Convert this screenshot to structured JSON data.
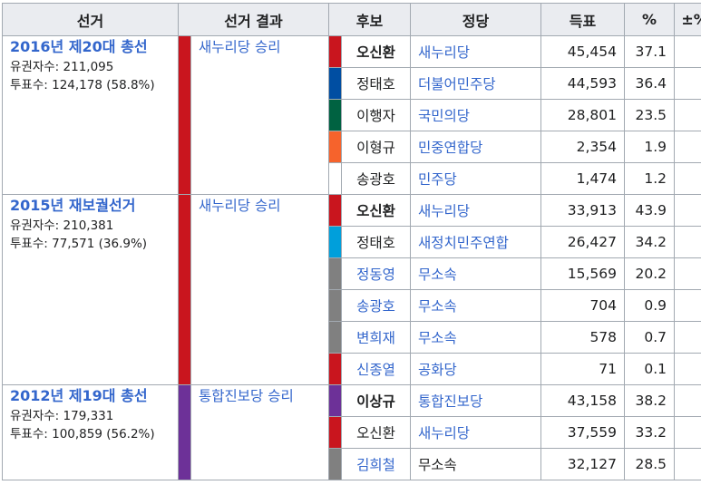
{
  "headers": {
    "election": "선거",
    "result": "선거 결과",
    "candidate": "후보",
    "party": "정당",
    "votes": "득표",
    "pct": "%",
    "change": "±%"
  },
  "elections": [
    {
      "title": "2016년 제20대 총선",
      "electors": "유권자수: 211,095",
      "turnout": "투표수: 124,178 (58.8%)",
      "result": "새누리당 승리",
      "result_color": "#c9151e",
      "candidates": [
        {
          "name": "오신환",
          "party": "새누리당",
          "votes": "45,454",
          "pct": "37.1",
          "change": "",
          "color": "#c9151e"
        },
        {
          "name": "정태호",
          "party": "더불어민주당",
          "votes": "44,593",
          "pct": "36.4",
          "change": "",
          "color": "#004ea2"
        },
        {
          "name": "이행자",
          "party": "국민의당",
          "votes": "28,801",
          "pct": "23.5",
          "change": "",
          "color": "#006241"
        },
        {
          "name": "이형규",
          "party": "민중연합당",
          "votes": "2,354",
          "pct": "1.9",
          "change": "",
          "color": "#f6632c"
        },
        {
          "name": "송광호",
          "party": "민주당",
          "votes": "1,474",
          "pct": "1.2",
          "change": "",
          "color": "#ffffff"
        }
      ]
    },
    {
      "title": "2015년 재보궐선거",
      "electors": "유권자수: 210,381",
      "turnout": "투표수: 77,571 (36.9%)",
      "result": "새누리당 승리",
      "result_color": "#c9151e",
      "candidates": [
        {
          "name": "오신환",
          "party": "새누리당",
          "votes": "33,913",
          "pct": "43.9",
          "change": "",
          "color": "#c9151e"
        },
        {
          "name": "정태호",
          "party": "새정치민주연합",
          "votes": "26,427",
          "pct": "34.2",
          "change": "",
          "color": "#009fdb"
        },
        {
          "name": "정동영",
          "party": "무소속",
          "votes": "15,569",
          "pct": "20.2",
          "change": "",
          "color": "#808080"
        },
        {
          "name": "송광호",
          "party": "무소속",
          "votes": "704",
          "pct": "0.9",
          "change": "",
          "color": "#808080"
        },
        {
          "name": "변희재",
          "party": "무소속",
          "votes": "578",
          "pct": "0.7",
          "change": "",
          "color": "#808080"
        },
        {
          "name": "신종열",
          "party": "공화당",
          "votes": "71",
          "pct": "0.1",
          "change": "",
          "color": "#c9151e"
        }
      ]
    },
    {
      "title": "2012년 제19대 총선",
      "electors": "유권자수: 179,331",
      "turnout": "투표수: 100,859 (56.2%)",
      "result": "통합진보당 승리",
      "result_color": "#6d3198",
      "candidates": [
        {
          "name": "이상규",
          "party": "통합진보당",
          "votes": "43,158",
          "pct": "38.2",
          "change": "",
          "color": "#6d3198"
        },
        {
          "name": "오신환",
          "party": "새누리당",
          "votes": "37,559",
          "pct": "33.2",
          "change": "",
          "color": "#c9151e"
        },
        {
          "name": "김희철",
          "party": "무소속",
          "votes": "32,127",
          "pct": "28.5",
          "change": "",
          "color": "#808080"
        }
      ]
    }
  ]
}
